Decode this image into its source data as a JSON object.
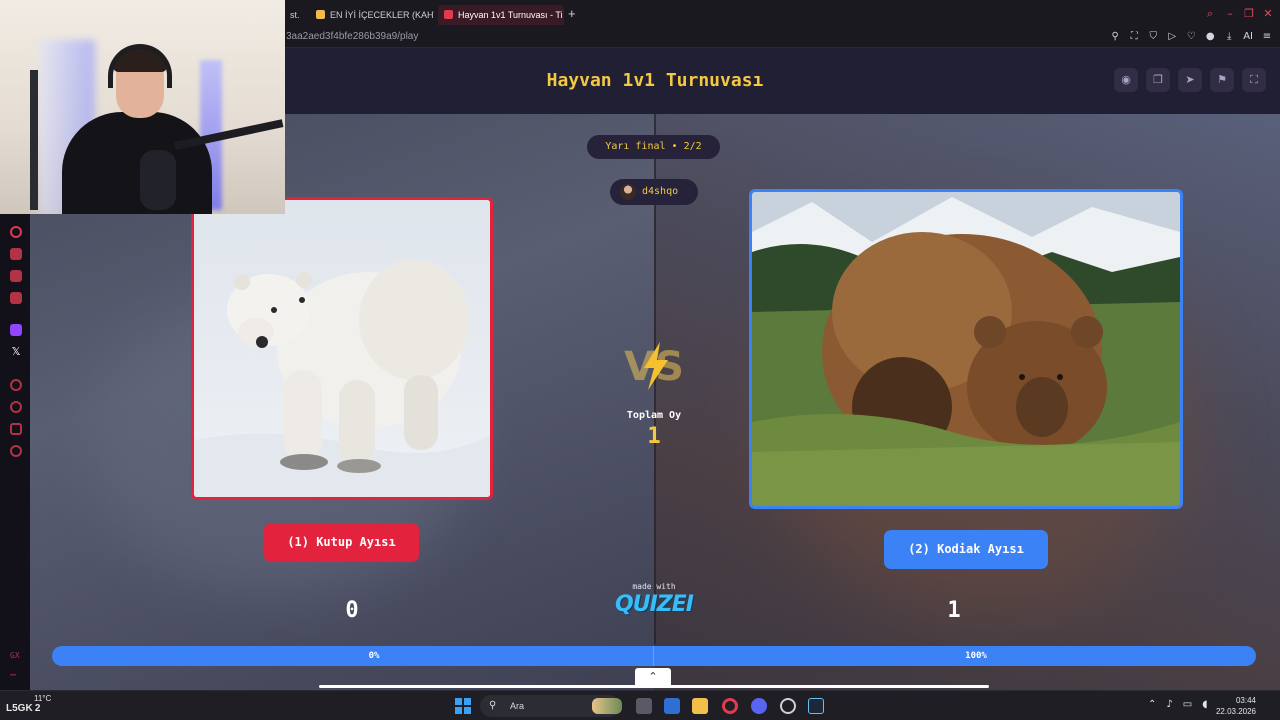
{
  "browser": {
    "tabs": [
      {
        "label": "st.",
        "favicon_color": "#7a7a7a"
      },
      {
        "label": "EN İYİ İÇECEKLER (KAHVE",
        "favicon_color": "#f5b84a"
      },
      {
        "label": "Hayvan 1v1 Turnuvası - Ti",
        "favicon_color": "#e03b4e"
      }
    ],
    "url": "3aa2aed3f4bfe286b39a9/play",
    "ai_label": "AI"
  },
  "header": {
    "title": "Hayvan 1v1 Turnuvası",
    "buttons": [
      "eye-icon",
      "copy-icon",
      "share-icon",
      "flag-icon",
      "fullscreen-icon"
    ]
  },
  "match": {
    "round": "Yarı final • 2/2",
    "username": "d4shqo",
    "vs_label": "VS",
    "total_votes_label": "Toplam Oy",
    "total_votes": "1",
    "left": {
      "name": "(1) Kutup Ayısı",
      "score": "0",
      "percent": "0%",
      "percent_value": 0
    },
    "right": {
      "name": "(2) Kodiak Ayısı",
      "score": "1",
      "percent": "100%",
      "percent_value": 100
    }
  },
  "branding": {
    "made_with": "made with",
    "logo": "QUIZEI"
  },
  "taskbar": {
    "weather_temp": "11°C",
    "weather_badge": "L5GK",
    "weather_sub": "2",
    "search_placeholder": "Ara",
    "time": "03:44",
    "date": "22.03.2026"
  },
  "colors": {
    "red": "#e3223e",
    "blue": "#3b82f6",
    "gold": "#f3c941"
  }
}
